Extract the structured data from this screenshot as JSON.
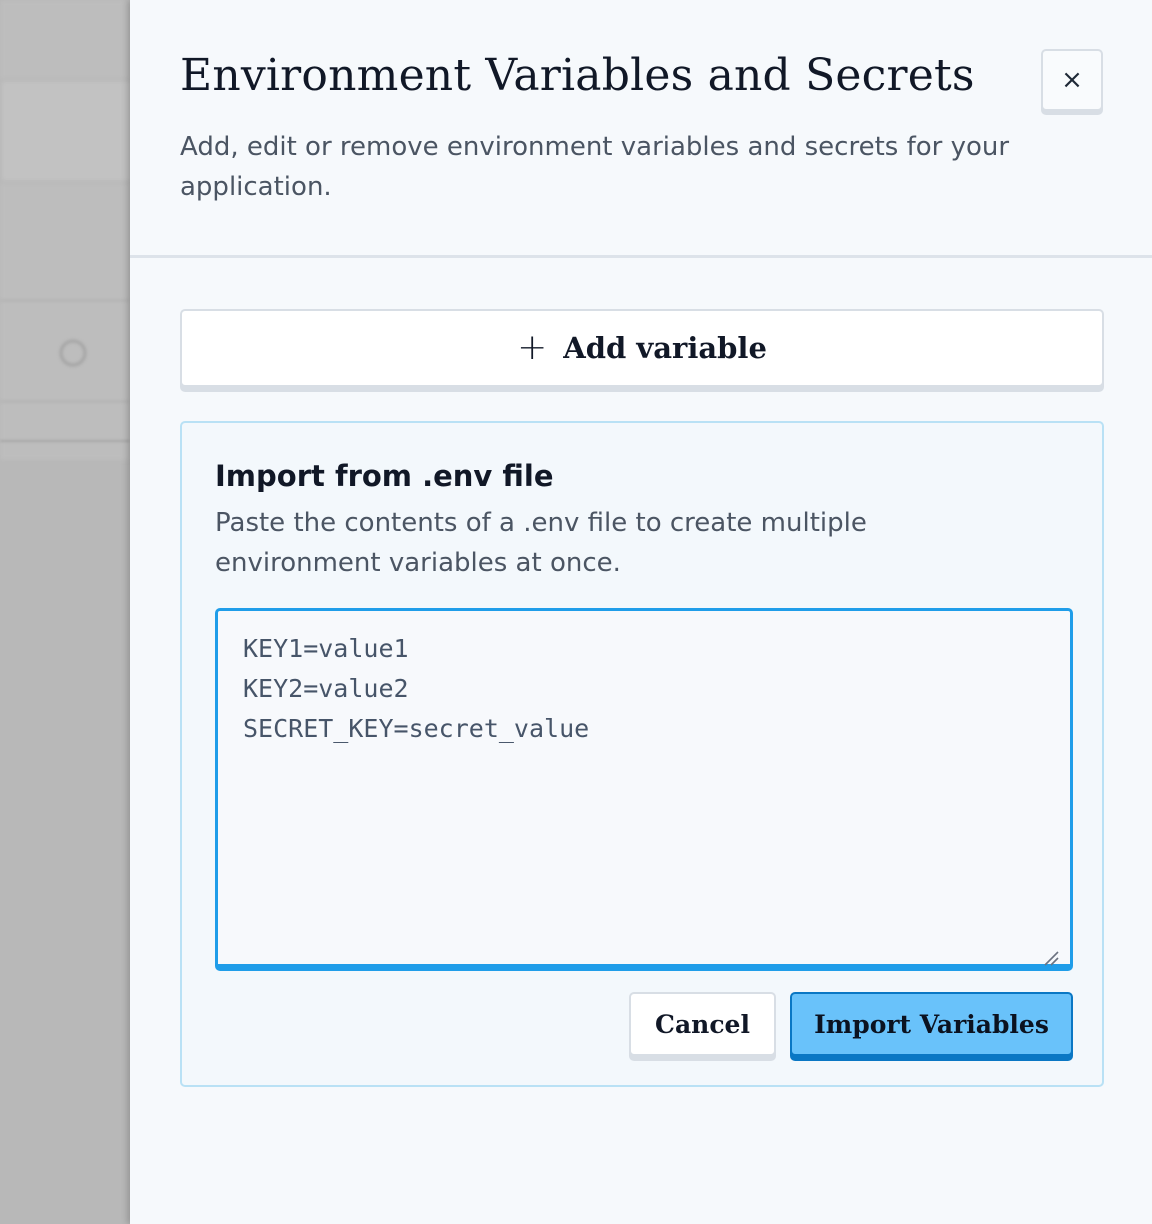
{
  "dialog": {
    "title": "Environment Variables and Secrets",
    "description": "Add, edit or remove environment variables and secrets for your application.",
    "close_label": "×",
    "close_icon": "close-icon"
  },
  "add_variable": {
    "icon": "plus-icon",
    "icon_glyph": "+",
    "label": "Add variable"
  },
  "import_section": {
    "title": "Import from .env file",
    "description": "Paste the contents of a .env file to create multiple environment variables at once.",
    "textarea_value": "KEY1=value1\nKEY2=value2\nSECRET_KEY=secret_value",
    "cancel_label": "Cancel",
    "import_label": "Import Variables"
  },
  "colors": {
    "accent": "#1f9de9",
    "primary_button": "#69c2fa",
    "primary_button_border": "#0a77c4",
    "panel_background": "#f6f9fc"
  }
}
